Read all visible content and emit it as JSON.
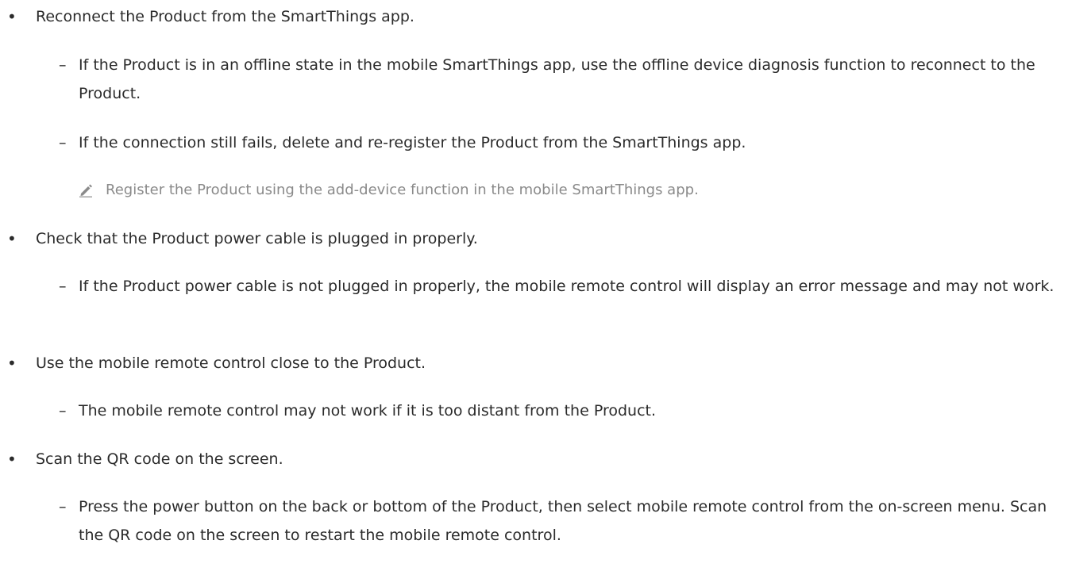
{
  "bullets": [
    {
      "text": "Reconnect the Product from the SmartThings app.",
      "subitems": [
        "If the Product is in an offline state in the mobile SmartThings app, use the offline device diagnosis function to reconnect to the Product.",
        "If the connection still fails, delete and re-register the Product from the SmartThings app."
      ],
      "note": "Register the Product using the add-device function in the mobile SmartThings app."
    },
    {
      "text": "Check that the Product power cable is plugged in properly.",
      "subitems": [
        "If the Product power cable is not plugged in properly, the mobile remote control will display an error message and may not work."
      ]
    },
    {
      "text": "Use the mobile remote control close to the Product.",
      "subitems": [
        "The mobile remote control may not work if it is too distant from the Product."
      ]
    },
    {
      "text": "Scan the QR code on the screen.",
      "subitems": [
        "Press the power button on the back or bottom of the Product, then select mobile remote control from the on-screen menu. Scan the QR code on the screen to restart the mobile remote control."
      ]
    }
  ],
  "icons": {
    "note": "pencil-icon"
  }
}
